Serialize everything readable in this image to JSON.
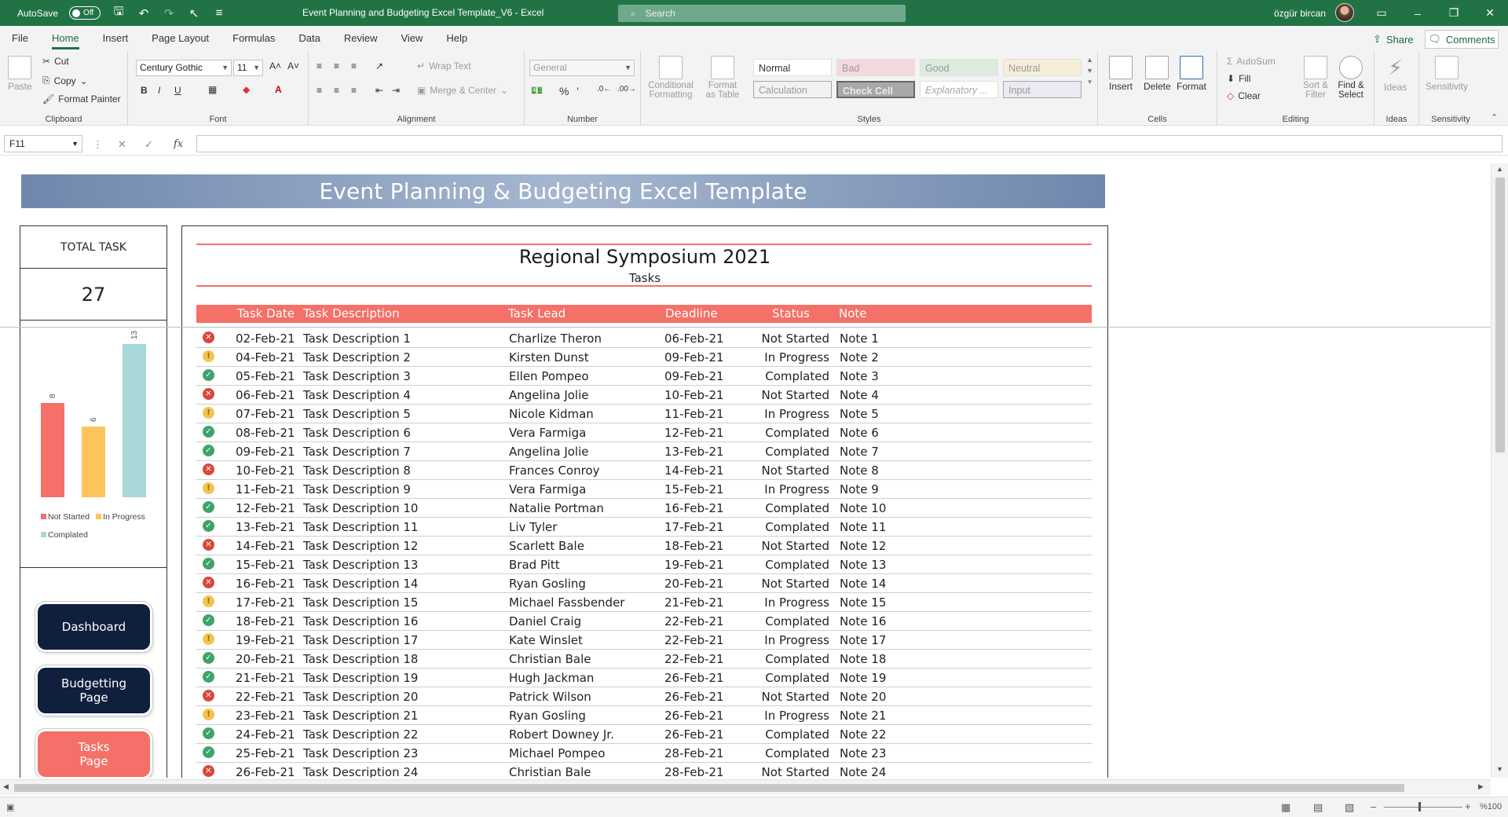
{
  "titlebar": {
    "autosave_label": "AutoSave",
    "autosave_state": "Off",
    "doc_title": "Event Planning and Budgeting Excel Template_V6  -  Excel",
    "search_placeholder": "Search",
    "user_name": "özgür bircan"
  },
  "ribbon_tabs": [
    "File",
    "Home",
    "Insert",
    "Page Layout",
    "Formulas",
    "Data",
    "Review",
    "View",
    "Help"
  ],
  "share_label": "Share",
  "comments_label": "Comments",
  "ribbon": {
    "clipboard": {
      "paste": "Paste",
      "cut": "Cut",
      "copy": "Copy",
      "format_painter": "Format Painter",
      "label": "Clipboard"
    },
    "font": {
      "family": "Century Gothic",
      "size": "11",
      "label": "Font"
    },
    "alignment": {
      "wrap": "Wrap Text",
      "merge": "Merge & Center",
      "label": "Alignment"
    },
    "number": {
      "format": "General",
      "label": "Number"
    },
    "styles": {
      "conditional": "Conditional Formatting",
      "format_table": "Format as Table",
      "cells": [
        "Normal",
        "Bad",
        "Good",
        "Neutral",
        "Calculation",
        "Check Cell",
        "Explanatory ...",
        "Input"
      ],
      "label": "Styles"
    },
    "cells": {
      "insert": "Insert",
      "delete": "Delete",
      "format": "Format",
      "label": "Cells"
    },
    "editing": {
      "autosum": "AutoSum",
      "fill": "Fill",
      "clear": "Clear",
      "sort": "Sort & Filter",
      "find": "Find & Select",
      "label": "Editing"
    },
    "ideas": {
      "ideas": "Ideas",
      "label": "Ideas"
    },
    "sensitivity": {
      "sensitivity": "Sensitivity",
      "label": "Sensitivity"
    }
  },
  "formula_bar": {
    "name_box": "F11",
    "fx": "fx",
    "formula": ""
  },
  "sheet": {
    "banner": "Event Planning & Budgeting Excel Template",
    "total_label": "TOTAL TASK",
    "total_value": "27",
    "nav": {
      "dashboard": "Dashboard",
      "budget_line1": "Budgetting",
      "budget_line2": "Page",
      "tasks_line1": "Tasks",
      "tasks_line2": "Page"
    },
    "event_title": "Regional Symposium 2021",
    "event_sub": "Tasks",
    "headers": {
      "date": "Task Date",
      "desc": "Task Description",
      "lead": "Task Lead",
      "deadline": "Deadline",
      "status": "Status",
      "note": "Note"
    }
  },
  "chart_data": {
    "type": "bar",
    "categories": [
      "Not Started",
      "In Progress",
      "Complated"
    ],
    "values": [
      8,
      6,
      13
    ],
    "colors": [
      "#f47068",
      "#fec45c",
      "#a8d8d8"
    ],
    "legend": [
      "Not Started",
      "In Progress",
      "Complated"
    ]
  },
  "tasks": [
    {
      "date": "02-Feb-21",
      "desc": "Task Description 1",
      "lead": "Charlize Theron",
      "deadline": "06-Feb-21",
      "status": "Not Started",
      "note": "Note 1"
    },
    {
      "date": "04-Feb-21",
      "desc": "Task Description 2",
      "lead": "Kirsten Dunst",
      "deadline": "09-Feb-21",
      "status": "In Progress",
      "note": "Note 2"
    },
    {
      "date": "05-Feb-21",
      "desc": "Task Description 3",
      "lead": "Ellen Pompeo",
      "deadline": "09-Feb-21",
      "status": "Complated",
      "note": "Note 3"
    },
    {
      "date": "06-Feb-21",
      "desc": "Task Description 4",
      "lead": "Angelina Jolie",
      "deadline": "10-Feb-21",
      "status": "Not Started",
      "note": "Note 4"
    },
    {
      "date": "07-Feb-21",
      "desc": "Task Description 5",
      "lead": "Nicole Kidman",
      "deadline": "11-Feb-21",
      "status": "In Progress",
      "note": "Note 5"
    },
    {
      "date": "08-Feb-21",
      "desc": "Task Description 6",
      "lead": "Vera Farmiga",
      "deadline": "12-Feb-21",
      "status": "Complated",
      "note": "Note 6"
    },
    {
      "date": "09-Feb-21",
      "desc": "Task Description 7",
      "lead": "Angelina Jolie",
      "deadline": "13-Feb-21",
      "status": "Complated",
      "note": "Note 7"
    },
    {
      "date": "10-Feb-21",
      "desc": "Task Description 8",
      "lead": "Frances Conroy",
      "deadline": "14-Feb-21",
      "status": "Not Started",
      "note": "Note 8"
    },
    {
      "date": "11-Feb-21",
      "desc": "Task Description 9",
      "lead": "Vera Farmiga",
      "deadline": "15-Feb-21",
      "status": "In Progress",
      "note": "Note 9"
    },
    {
      "date": "12-Feb-21",
      "desc": "Task Description 10",
      "lead": "Natalie Portman",
      "deadline": "16-Feb-21",
      "status": "Complated",
      "note": "Note 10"
    },
    {
      "date": "13-Feb-21",
      "desc": "Task Description 11",
      "lead": "Liv Tyler",
      "deadline": "17-Feb-21",
      "status": "Complated",
      "note": "Note 11"
    },
    {
      "date": "14-Feb-21",
      "desc": "Task Description 12",
      "lead": "Scarlett Bale",
      "deadline": "18-Feb-21",
      "status": "Not Started",
      "note": "Note 12"
    },
    {
      "date": "15-Feb-21",
      "desc": "Task Description 13",
      "lead": "Brad Pitt",
      "deadline": "19-Feb-21",
      "status": "Complated",
      "note": "Note 13"
    },
    {
      "date": "16-Feb-21",
      "desc": "Task Description 14",
      "lead": "Ryan Gosling",
      "deadline": "20-Feb-21",
      "status": "Not Started",
      "note": "Note 14"
    },
    {
      "date": "17-Feb-21",
      "desc": "Task Description 15",
      "lead": "Michael Fassbender",
      "deadline": "21-Feb-21",
      "status": "In Progress",
      "note": "Note 15"
    },
    {
      "date": "18-Feb-21",
      "desc": "Task Description 16",
      "lead": "Daniel Craig",
      "deadline": "22-Feb-21",
      "status": "Complated",
      "note": "Note 16"
    },
    {
      "date": "19-Feb-21",
      "desc": "Task Description 17",
      "lead": "Kate Winslet",
      "deadline": "22-Feb-21",
      "status": "In Progress",
      "note": "Note 17"
    },
    {
      "date": "20-Feb-21",
      "desc": "Task Description 18",
      "lead": "Christian Bale",
      "deadline": "22-Feb-21",
      "status": "Complated",
      "note": "Note 18"
    },
    {
      "date": "21-Feb-21",
      "desc": "Task Description 19",
      "lead": "Hugh Jackman",
      "deadline": "26-Feb-21",
      "status": "Complated",
      "note": "Note 19"
    },
    {
      "date": "22-Feb-21",
      "desc": "Task Description 20",
      "lead": "Patrick Wilson",
      "deadline": "26-Feb-21",
      "status": "Not Started",
      "note": "Note 20"
    },
    {
      "date": "23-Feb-21",
      "desc": "Task Description 21",
      "lead": "Ryan Gosling",
      "deadline": "26-Feb-21",
      "status": "In Progress",
      "note": "Note 21"
    },
    {
      "date": "24-Feb-21",
      "desc": "Task Description 22",
      "lead": "Robert Downey Jr.",
      "deadline": "26-Feb-21",
      "status": "Complated",
      "note": "Note 22"
    },
    {
      "date": "25-Feb-21",
      "desc": "Task Description 23",
      "lead": "Michael Pompeo",
      "deadline": "28-Feb-21",
      "status": "Complated",
      "note": "Note 23"
    },
    {
      "date": "26-Feb-21",
      "desc": "Task Description 24",
      "lead": "Christian Bale",
      "deadline": "28-Feb-21",
      "status": "Not Started",
      "note": "Note 24"
    }
  ],
  "statusbar": {
    "zoom": "%100"
  }
}
